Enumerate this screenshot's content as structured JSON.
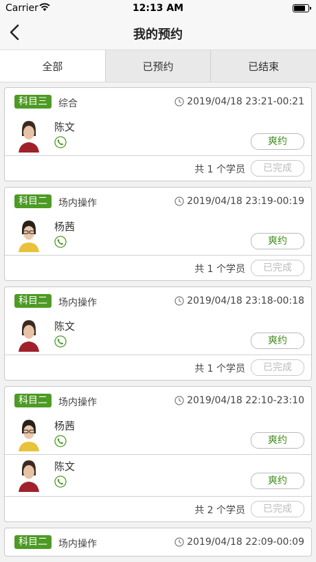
{
  "status": {
    "carrier": "Carrier",
    "time": "12:13 AM",
    "battery_level": 0.8
  },
  "nav": {
    "title": "我的预约"
  },
  "tabs": [
    {
      "label": "全部",
      "active": true
    },
    {
      "label": "已预约",
      "active": false
    },
    {
      "label": "已结束",
      "active": false
    }
  ],
  "cards": [
    {
      "subject": "科目三",
      "type": "综合",
      "time": "2019/04/18 23:21-00:21",
      "students": [
        {
          "name": "陈文",
          "avatar": "female",
          "cancel_label": "爽约"
        }
      ],
      "total": "共 1 个学员",
      "status_label": "已完成"
    },
    {
      "subject": "科目二",
      "type": "场内操作",
      "time": "2019/04/18 23:19-00:19",
      "students": [
        {
          "name": "杨茜",
          "avatar": "female-glasses",
          "cancel_label": "爽约"
        }
      ],
      "total": "共 1 个学员",
      "status_label": "已完成"
    },
    {
      "subject": "科目二",
      "type": "场内操作",
      "time": "2019/04/18 23:18-00:18",
      "students": [
        {
          "name": "陈文",
          "avatar": "female",
          "cancel_label": "爽约"
        }
      ],
      "total": "共 1 个学员",
      "status_label": "已完成"
    },
    {
      "subject": "科目二",
      "type": "场内操作",
      "time": "2019/04/18 22:10-23:10",
      "students": [
        {
          "name": "杨茜",
          "avatar": "female-glasses",
          "cancel_label": "爽约"
        },
        {
          "name": "陈文",
          "avatar": "female",
          "cancel_label": "爽约"
        }
      ],
      "total": "共 2 个学员",
      "status_label": "已完成"
    },
    {
      "subject": "科目二",
      "type": "场内操作",
      "time": "2019/04/18 22:09-00:09",
      "students": [],
      "total": "",
      "status_label": ""
    }
  ],
  "colors": {
    "accent": "#4d9a24",
    "cancel_text": "#3d8a17"
  }
}
